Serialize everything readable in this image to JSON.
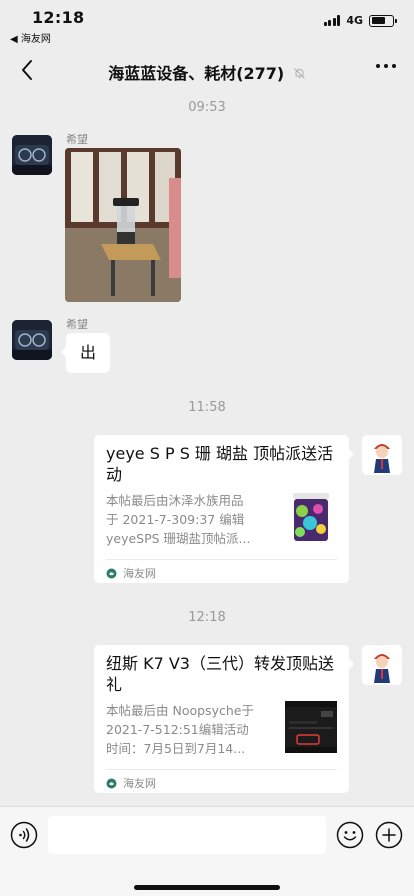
{
  "status_bar": {
    "time": "12:18",
    "back_app": "◀ 海友网",
    "network": "4G",
    "battery_level": 0.65
  },
  "header": {
    "title": "海蓝蓝设备、耗材(277)",
    "back_icon": "chevron-left-icon",
    "muted_icon": "bell-off-icon",
    "more_icon": "more-dots-icon"
  },
  "messages": [
    {
      "type": "time",
      "text": "09:53"
    },
    {
      "type": "image",
      "sender": "希望",
      "side": "left"
    },
    {
      "type": "text",
      "sender": "希望",
      "side": "left",
      "text": "出"
    },
    {
      "type": "time",
      "text": "11:58"
    },
    {
      "type": "link",
      "side": "right",
      "title": "yeye S P S 珊 瑚盐 顶帖派送活动",
      "desc": [
        "本帖最后由沐泽水族用品",
        "于 2021-7-309:37 编辑",
        "yeyeSPS 珊瑚盐顶帖派..."
      ],
      "source": "海友网"
    },
    {
      "type": "time",
      "text": "12:18"
    },
    {
      "type": "link",
      "side": "right",
      "title": "纽斯 K7 V3（三代）转发顶贴送礼",
      "desc": [
        "本帖最后由 Noopsyche于",
        "2021-7-512:51编辑活动",
        "时间：7月5日到7月14..."
      ],
      "source": "海友网"
    }
  ],
  "input_bar": {
    "placeholder": "",
    "voice_icon": "voice-icon",
    "emoji_icon": "emoji-icon",
    "plus_icon": "plus-icon"
  },
  "colors": {
    "background": "#ededed",
    "bubble": "#ffffff",
    "secondary_text": "#8a8a8a",
    "source_badge": "#2e7d6b"
  }
}
